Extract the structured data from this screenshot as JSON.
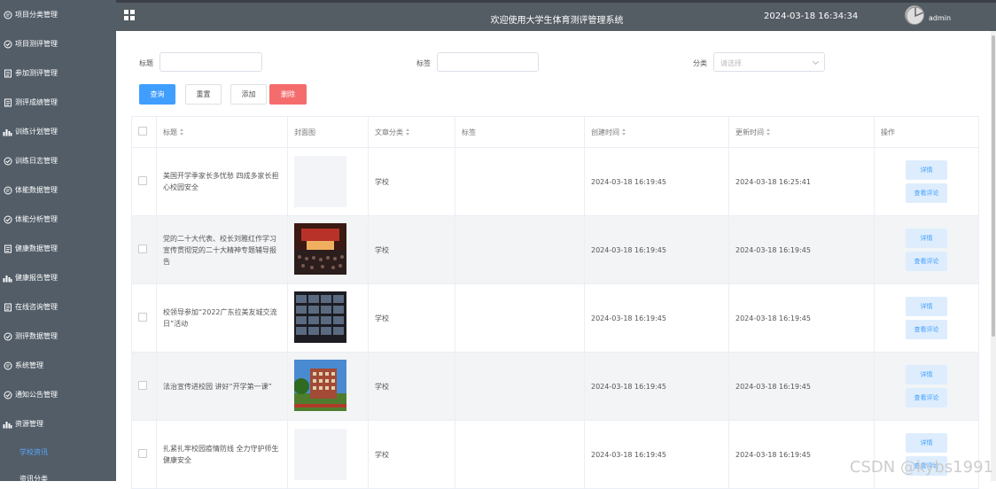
{
  "sidebar": {
    "items": [
      {
        "label": "项目分类管理",
        "icon": "chat-icon"
      },
      {
        "label": "项目测评管理",
        "icon": "check-circle-icon"
      },
      {
        "label": "参加测评管理",
        "icon": "document-icon"
      },
      {
        "label": "测评成绩管理",
        "icon": "document-icon"
      },
      {
        "label": "训练计划管理",
        "icon": "bar-chart-icon"
      },
      {
        "label": "训练日志管理",
        "icon": "check-circle-icon"
      },
      {
        "label": "体能数据管理",
        "icon": "chat-icon"
      },
      {
        "label": "体能分析管理",
        "icon": "check-circle-icon"
      },
      {
        "label": "健康数据管理",
        "icon": "document-icon"
      },
      {
        "label": "健康报告管理",
        "icon": "bar-chart-icon"
      },
      {
        "label": "在线咨询管理",
        "icon": "document-icon"
      },
      {
        "label": "测评数据管理",
        "icon": "check-circle-icon"
      },
      {
        "label": "系统管理",
        "icon": "chat-icon"
      },
      {
        "label": "通知公告管理",
        "icon": "check-circle-icon"
      },
      {
        "label": "资源管理",
        "icon": "bar-chart-icon"
      }
    ],
    "subitems": [
      {
        "label": "学校资讯",
        "active": true
      },
      {
        "label": "资讯分类",
        "active": false
      }
    ]
  },
  "header": {
    "title": "欢迎使用大学生体育测评管理系统",
    "datetime": "2024-03-18 16:34:34",
    "username": "admin"
  },
  "filters": {
    "title_label": "标题",
    "tag_label": "标签",
    "category_label": "分类",
    "category_placeholder": "请选择"
  },
  "actions": {
    "query": "查询",
    "reset": "重置",
    "add": "添加",
    "delete": "删除"
  },
  "table": {
    "columns": [
      "标题",
      "封面图",
      "文章分类",
      "标签",
      "创建时间",
      "更新时间",
      "操作"
    ],
    "rows": [
      {
        "title": "美国开学季家长多忧愁 四成多家长担心校园安全",
        "cover": "blank",
        "category": "学校",
        "tag": "",
        "created": "2024-03-18 16:19:45",
        "updated": "2024-03-18 16:25:41"
      },
      {
        "title": "党的二十大代表、校长刘雅红作学习宣传贯彻党的二十大精神专题辅导报告",
        "cover": "auditorium",
        "category": "学校",
        "tag": "",
        "created": "2024-03-18 16:19:45",
        "updated": "2024-03-18 16:19:45"
      },
      {
        "title": "校领导参加“2022广东拉美友城交流日”活动",
        "cover": "video-conference",
        "category": "学校",
        "tag": "",
        "created": "2024-03-18 16:19:45",
        "updated": "2024-03-18 16:19:45"
      },
      {
        "title": "法治宣传进校园 讲好“开学第一课”",
        "cover": "campus-building",
        "category": "学校",
        "tag": "",
        "created": "2024-03-18 16:19:45",
        "updated": "2024-03-18 16:19:45"
      },
      {
        "title": "扎紧扎牢校园疫情防线 全力守护师生健康安全",
        "cover": "blank",
        "category": "学校",
        "tag": "",
        "created": "2024-03-18 16:19:45",
        "updated": "2024-03-18 16:19:45"
      }
    ],
    "detail_label": "详情",
    "comments_label": "查看评论"
  },
  "watermark": "CSDN @kybs1991",
  "colors": {
    "sidebar_bg": "#525d68",
    "header_bg": "#545c64",
    "primary": "#409eff",
    "danger": "#f56c6c",
    "active_sub": "#5aa8ff"
  }
}
